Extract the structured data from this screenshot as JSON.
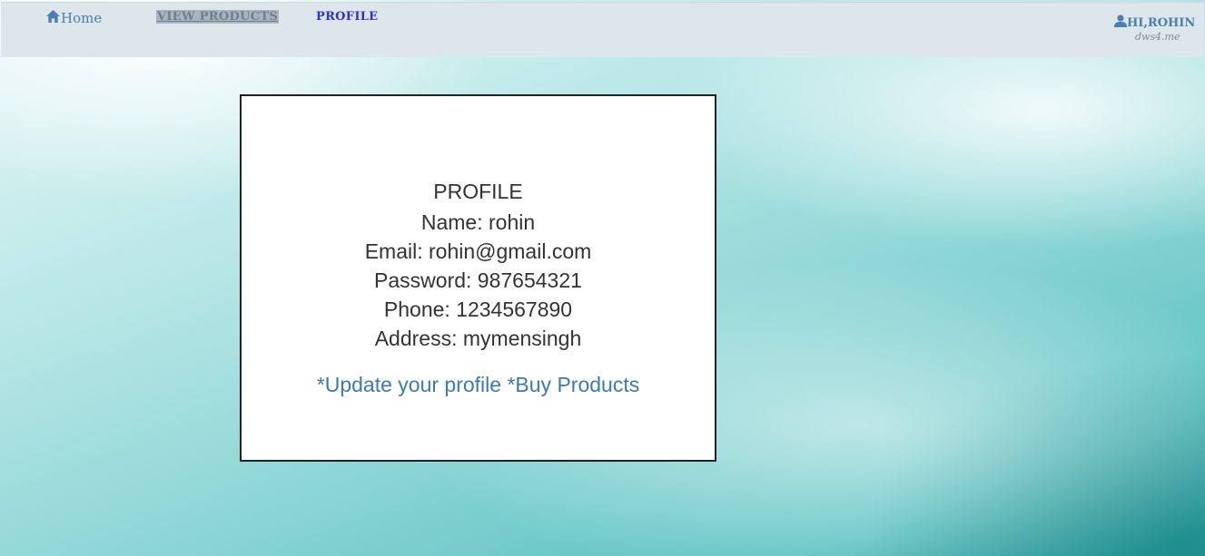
{
  "nav": {
    "home_label": "Home",
    "view_products_label": "VIEW PRODUCTS",
    "profile_label": "PROFILE",
    "user_greeting": "HI,ROHIN",
    "user_sub": "dws4.me"
  },
  "profile": {
    "title": "PROFILE",
    "name": "Name: rohin",
    "email": "Email: rohin@gmail.com",
    "password": "Password: 987654321",
    "phone": "Phone: 1234567890",
    "address": "Address: mymensingh",
    "update_link": "*Update your profile",
    "buy_link": "*Buy Products"
  }
}
